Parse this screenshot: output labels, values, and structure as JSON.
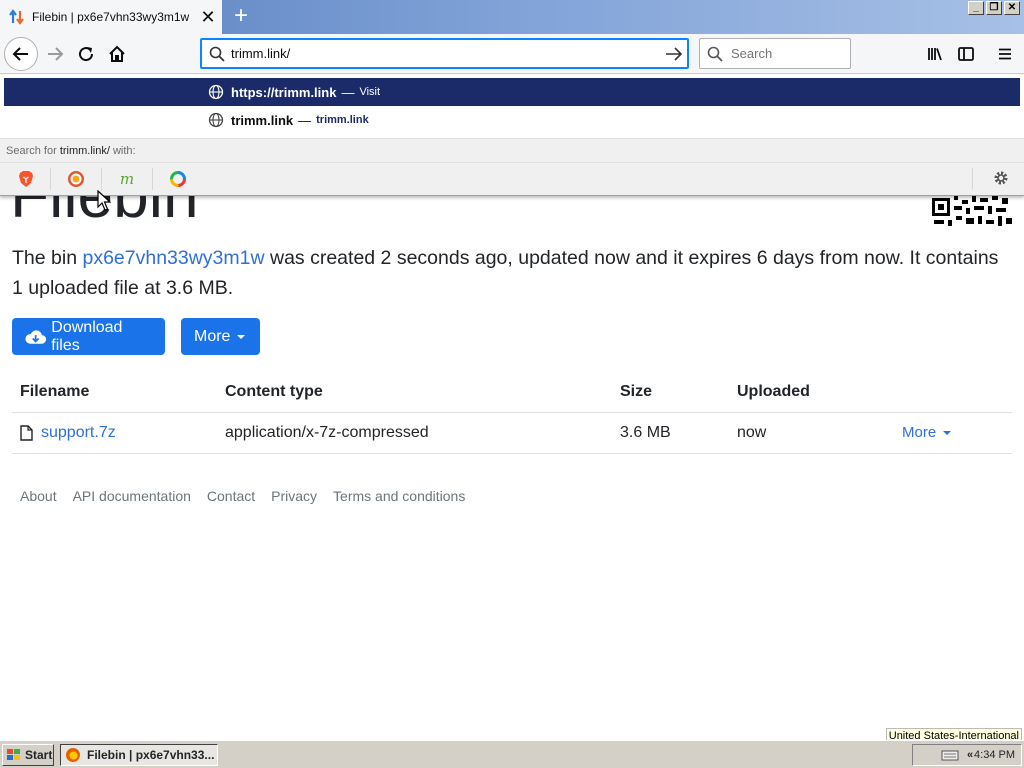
{
  "browser": {
    "tab": {
      "title": "Filebin | px6e7vhn33wy3m1w",
      "close": "✕"
    },
    "new_tab": "+",
    "window_controls": [
      "_",
      "❐",
      "✕"
    ],
    "url_value": "trimm.link/",
    "search_placeholder": "Search"
  },
  "dropdown": {
    "row1": {
      "url": "https://trimm.link",
      "sep": "—",
      "action": "Visit"
    },
    "row2": {
      "url": "trimm.link",
      "sep": "—",
      "action": "trimm.link"
    },
    "search_prefix": "Search for ",
    "search_term": "trimm.link/",
    "search_suffix": " with:",
    "engines": [
      "brave",
      "duckduckgo",
      "mojeek",
      "qwant"
    ]
  },
  "page": {
    "title": "Filebin",
    "summary_pre": "The bin ",
    "bin_id": "px6e7vhn33wy3m1w",
    "summary_post": " was created 2 seconds ago, updated now and it expires 6 days from now. It contains 1 uploaded file at 3.6 MB.",
    "download_label": "Download files",
    "more_label": "More",
    "table": {
      "headers": [
        "Filename",
        "Content type",
        "Size",
        "Uploaded"
      ],
      "rows": [
        {
          "filename": "support.7z",
          "content_type": "application/x-7z-compressed",
          "size": "3.6 MB",
          "uploaded": "now",
          "more": "More"
        }
      ]
    },
    "footer": [
      "About",
      "API documentation",
      "Contact",
      "Privacy",
      "Terms and conditions"
    ]
  },
  "taskbar": {
    "language": "United States-International",
    "start_label": "Start",
    "task_label": "Filebin | px6e7vhn33...",
    "tray_arrows": "«",
    "clock": "4:34 PM"
  },
  "colors": {
    "accent": "#1a73e8",
    "link": "#2f6fd8",
    "dropdown_highlight": "#1b2a68",
    "urlbar_focus": "#0a84ff"
  }
}
